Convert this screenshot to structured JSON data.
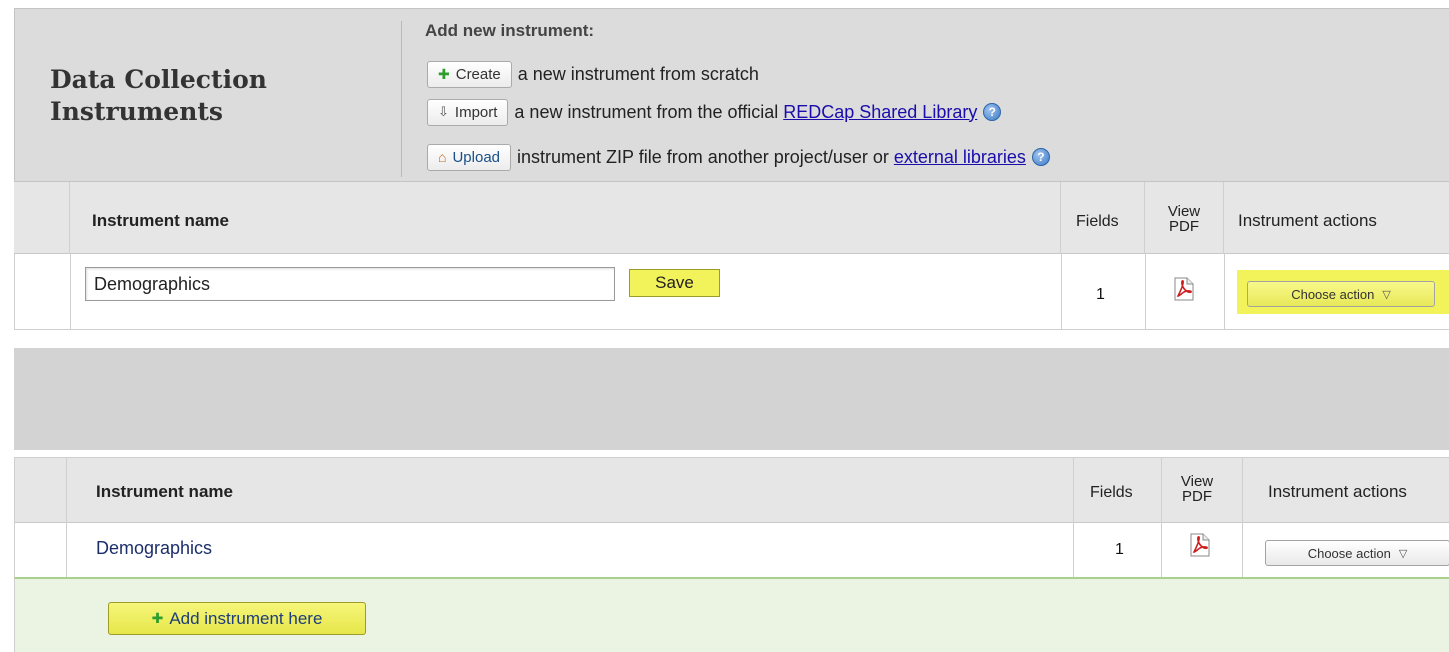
{
  "top_panel": {
    "title": "Data Collection Instruments",
    "add_new_label": "Add new instrument:",
    "create": {
      "button": "Create",
      "description": "a new instrument from scratch"
    },
    "import": {
      "button": "Import",
      "description_prefix": "a new instrument from the official",
      "link": "REDCap Shared Library"
    },
    "upload": {
      "button": "Upload",
      "description_prefix": "instrument ZIP file from another project/user or",
      "link": "external libraries"
    },
    "table": {
      "col_name": "Instrument name",
      "col_fields": "Fields",
      "col_pdf_line1": "View",
      "col_pdf_line2": "PDF",
      "col_actions": "Instrument actions",
      "row": {
        "name_input_value": "Demographics",
        "save_label": "Save",
        "fields": "1",
        "action_label": "Choose action"
      }
    }
  },
  "bottom_panel": {
    "table": {
      "col_name": "Instrument name",
      "col_fields": "Fields",
      "col_pdf_line1": "View",
      "col_pdf_line2": "PDF",
      "col_actions": "Instrument actions",
      "row": {
        "name": "Demographics",
        "fields": "1",
        "action_label": "Choose action"
      }
    },
    "add_instrument_label": "Add instrument here"
  },
  "colors": {
    "highlight_yellow": "#f2f25a",
    "header_gray": "#dcdcdc",
    "add_row_green": "#ebf3e3",
    "link_blue": "#1a0dab"
  }
}
